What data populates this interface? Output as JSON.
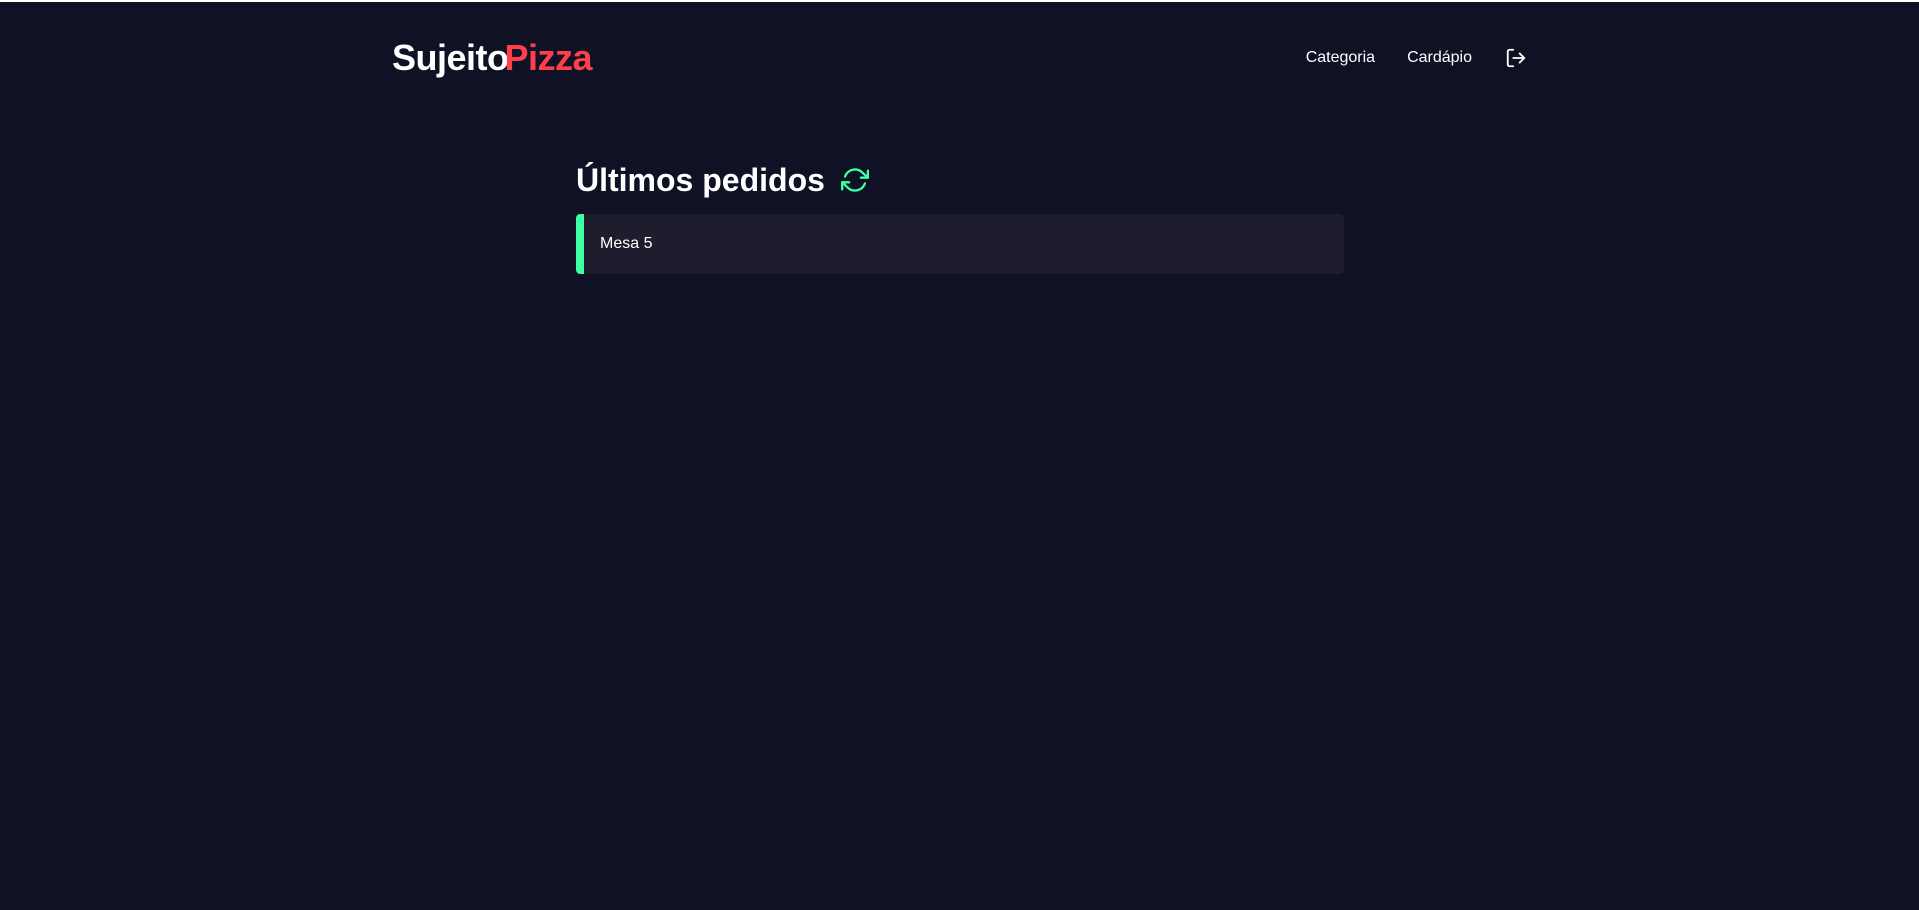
{
  "header": {
    "logo": {
      "part1": "Sujeito",
      "part2": "Pizza"
    },
    "nav": [
      {
        "label": "Categoria"
      },
      {
        "label": "Cardápio"
      }
    ],
    "logout_icon": "logout-icon"
  },
  "main": {
    "title": "Últimos pedidos",
    "refresh_icon": "refresh-icon",
    "orders": [
      {
        "label": "Mesa 5"
      }
    ]
  },
  "colors": {
    "background": "#0f1124",
    "brand_red": "#ff3f4b",
    "accent_green": "#3fffa3",
    "card": "#1d1d2e",
    "text": "#ffffff"
  }
}
